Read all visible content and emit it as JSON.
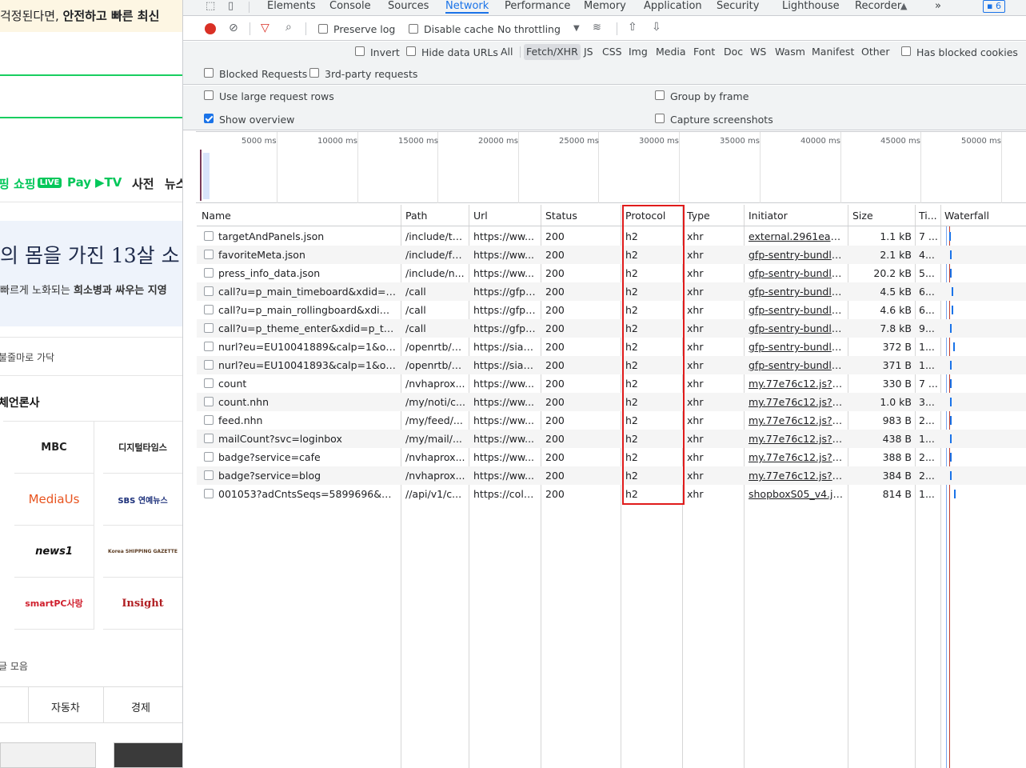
{
  "left_page": {
    "notice_text": "걱정된다면, ",
    "notice_bold": "안전하고 빠른 최신",
    "services": [
      {
        "label": "핑",
        "color": "green"
      },
      {
        "label": "쇼핑",
        "color": "green",
        "badge": "LIVE"
      },
      {
        "label": "Pay",
        "color": "green"
      },
      {
        "label": "▶TV",
        "color": "green"
      },
      {
        "label": "사전",
        "color": "black"
      },
      {
        "label": "뉴스",
        "color": "black"
      }
    ],
    "headline": "의 몸을 가진 13살 소",
    "subline_normal": "빠르게 노화되는 ",
    "subline_bold": "희소병과 싸우는 지영",
    "caption": "불줄마로 가닥",
    "section_title": "체언론사",
    "press": [
      "MBC",
      "디지털타임스",
      "MediaUs",
      "SBS 연예뉴스",
      "news1",
      "Korea SHIPPING GAZETTE",
      "smartPC사랑",
      "Insight"
    ],
    "bottom_caption": "글 모음",
    "bottom_tabs": [
      "자동차",
      "경제"
    ]
  },
  "devtools": {
    "tabs": [
      "Elements",
      "Console",
      "Sources",
      "Network",
      "Performance",
      "Memory",
      "Application",
      "Security",
      "Lighthouse",
      "Recorder"
    ],
    "active_tab": "Network",
    "more_tabs": "»",
    "issues_count": "6",
    "toolbar": {
      "preserve_log": "Preserve log",
      "disable_cache": "Disable cache",
      "throttling": "No throttling"
    },
    "filter_placeholder": "Filter",
    "filter_options": {
      "invert": "Invert",
      "hide_data_urls": "Hide data URLs",
      "types": [
        "All",
        "Fetch/XHR",
        "JS",
        "CSS",
        "Img",
        "Media",
        "Font",
        "Doc",
        "WS",
        "Wasm",
        "Manifest",
        "Other"
      ],
      "active_type": "Fetch/XHR",
      "has_blocked_cookies": "Has blocked cookies",
      "blocked_requests": "Blocked Requests",
      "third_party": "3rd-party requests"
    },
    "settings": {
      "large_rows": "Use large request rows",
      "group_by_frame": "Group by frame",
      "show_overview": "Show overview",
      "show_overview_checked": true,
      "capture_screenshots": "Capture screenshots"
    },
    "overview_ticks": [
      "5000 ms",
      "10000 ms",
      "15000 ms",
      "20000 ms",
      "25000 ms",
      "30000 ms",
      "35000 ms",
      "40000 ms",
      "45000 ms",
      "50000 ms"
    ],
    "columns": [
      "Name",
      "Path",
      "Url",
      "Status",
      "Protocol",
      "Type",
      "Initiator",
      "Size",
      "Ti...",
      "Waterfall"
    ],
    "rows": [
      {
        "name": "targetAndPanels.json",
        "path": "/include/th...",
        "url": "https://ww...",
        "status": "200",
        "protocol": "h2",
        "type": "xhr",
        "initiator": "external.2961eaa5....",
        "size": "1.1 kB",
        "time": "7 ..."
      },
      {
        "name": "favoriteMeta.json",
        "path": "/include/fa...",
        "url": "https://ww...",
        "status": "200",
        "protocol": "h2",
        "type": "xhr",
        "initiator": "gfp-sentry-bundle...",
        "size": "2.1 kB",
        "time": "4..."
      },
      {
        "name": "press_info_data.json",
        "path": "/include/n...",
        "url": "https://ww...",
        "status": "200",
        "protocol": "h2",
        "type": "xhr",
        "initiator": "gfp-sentry-bundle...",
        "size": "20.2 kB",
        "time": "5..."
      },
      {
        "name": "call?u=p_main_timeboard&xdid=vet...",
        "path": "/call",
        "url": "https://gfp....",
        "status": "200",
        "protocol": "h2",
        "type": "xhr",
        "initiator": "gfp-sentry-bundle...",
        "size": "4.5 kB",
        "time": "6..."
      },
      {
        "name": "call?u=p_main_rollingboard&xdid=v...",
        "path": "/call",
        "url": "https://gfp....",
        "status": "200",
        "protocol": "h2",
        "type": "xhr",
        "initiator": "gfp-sentry-bundle...",
        "size": "4.6 kB",
        "time": "6..."
      },
      {
        "name": "call?u=p_theme_enter&xdid=p_the...",
        "path": "/call",
        "url": "https://gfp....",
        "status": "200",
        "protocol": "h2",
        "type": "xhr",
        "initiator": "gfp-sentry-bundle...",
        "size": "7.8 kB",
        "time": "9..."
      },
      {
        "name": "nurl?eu=EU10041889&calp=1&oj=...",
        "path": "/openrtb/n...",
        "url": "https://siap...",
        "status": "200",
        "protocol": "h2",
        "type": "xhr",
        "initiator": "gfp-sentry-bundle...",
        "size": "372 B",
        "time": "1..."
      },
      {
        "name": "nurl?eu=EU10041893&calp=1&oj=Z...",
        "path": "/openrtb/n...",
        "url": "https://siap...",
        "status": "200",
        "protocol": "h2",
        "type": "xhr",
        "initiator": "gfp-sentry-bundle...",
        "size": "371 B",
        "time": "1..."
      },
      {
        "name": "count",
        "path": "/nvhaprox...",
        "url": "https://ww...",
        "status": "200",
        "protocol": "h2",
        "type": "xhr",
        "initiator": "my.77e76c12.js?o...",
        "size": "330 B",
        "time": "7 ..."
      },
      {
        "name": "count.nhn",
        "path": "/my/noti/c...",
        "url": "https://ww...",
        "status": "200",
        "protocol": "h2",
        "type": "xhr",
        "initiator": "my.77e76c12.js?o...",
        "size": "1.0 kB",
        "time": "3..."
      },
      {
        "name": "feed.nhn",
        "path": "/my/feed/...",
        "url": "https://ww...",
        "status": "200",
        "protocol": "h2",
        "type": "xhr",
        "initiator": "my.77e76c12.js?o...",
        "size": "983 B",
        "time": "2..."
      },
      {
        "name": "mailCount?svc=loginbox",
        "path": "/my/mail/...",
        "url": "https://ww...",
        "status": "200",
        "protocol": "h2",
        "type": "xhr",
        "initiator": "my.77e76c12.js?o...",
        "size": "438 B",
        "time": "1..."
      },
      {
        "name": "badge?service=cafe",
        "path": "/nvhaprox...",
        "url": "https://ww...",
        "status": "200",
        "protocol": "h2",
        "type": "xhr",
        "initiator": "my.77e76c12.js?o...",
        "size": "388 B",
        "time": "2..."
      },
      {
        "name": "badge?service=blog",
        "path": "/nvhaprox...",
        "url": "https://ww...",
        "status": "200",
        "protocol": "h2",
        "type": "xhr",
        "initiator": "my.77e76c12.js?o...",
        "size": "384 B",
        "time": "2..."
      },
      {
        "name": "001053?adCntsSeqs=5899696&adC...",
        "path": "//api/v1/c...",
        "url": "https://colo...",
        "status": "200",
        "protocol": "h2",
        "type": "xhr",
        "initiator": "shopboxS05_v4.js?...",
        "size": "814 B",
        "time": "1..."
      }
    ],
    "accent_color": "#1a73e8",
    "highlight_color": "#e01b1b"
  }
}
